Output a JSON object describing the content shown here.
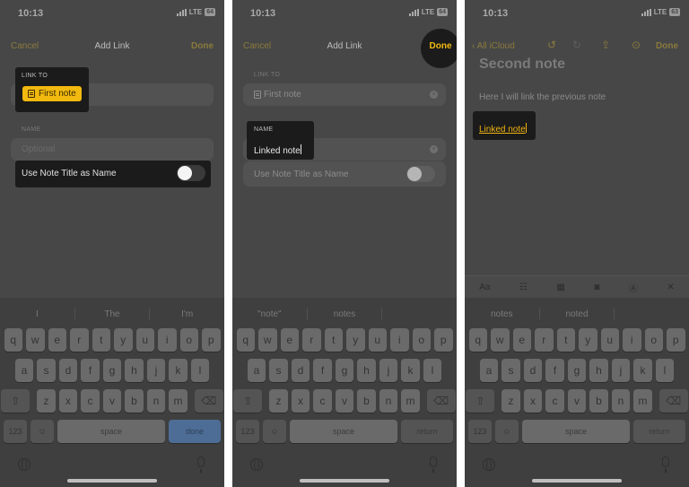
{
  "panels": [
    {
      "time": "10:13",
      "carrier": "LTE",
      "battery": "64",
      "nav": {
        "left": "Cancel",
        "title": "Add Link",
        "right": "Done"
      },
      "link_to_label": "LINK TO",
      "link_to_value": "First note",
      "name_label": "NAME",
      "name_placeholder": "Optional",
      "toggle_label": "Use Note Title as Name",
      "suggestions": [
        "I",
        "The",
        "I'm"
      ],
      "action_key": "done"
    },
    {
      "time": "10:13",
      "carrier": "LTE",
      "battery": "64",
      "nav": {
        "left": "Cancel",
        "title": "Add Link",
        "right": "Done"
      },
      "link_to_label": "LINK TO",
      "link_to_value": "First note",
      "name_label": "NAME",
      "name_value": "Linked note",
      "toggle_label": "Use Note Title as Name",
      "suggestions": [
        "\"note\"",
        "notes"
      ],
      "action_key": "return"
    },
    {
      "time": "10:13",
      "carrier": "LTE",
      "battery": "63",
      "nav": {
        "back": "All iCloud",
        "right": "Done"
      },
      "title": "Second note",
      "body": "Here I will link the previous note",
      "link_text": "Linked note",
      "format_bar": [
        "Aa"
      ],
      "suggestions": [
        "notes",
        "noted"
      ],
      "action_key": "return"
    }
  ],
  "keyboard": {
    "row1": [
      "q",
      "w",
      "e",
      "r",
      "t",
      "y",
      "u",
      "i",
      "o",
      "p"
    ],
    "row2": [
      "a",
      "s",
      "d",
      "f",
      "g",
      "h",
      "j",
      "k",
      "l"
    ],
    "row3": [
      "z",
      "x",
      "c",
      "v",
      "b",
      "n",
      "m"
    ],
    "num_key": "123",
    "space": "space"
  },
  "colors": {
    "accent": "#f2b90f",
    "dim_accent": "#8a7a3c",
    "background": "#474747"
  }
}
